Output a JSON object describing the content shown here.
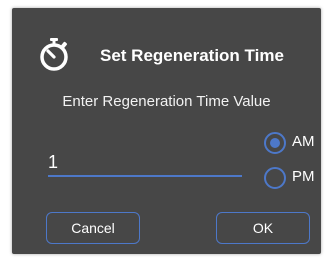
{
  "dialog": {
    "title": "Set Regeneration Time",
    "icon": "stopwatch-icon",
    "prompt": "Enter Regeneration Time Value",
    "time_value": "1",
    "meridiem": {
      "options": [
        "AM",
        "PM"
      ],
      "selected": "AM"
    },
    "buttons": {
      "cancel": "Cancel",
      "ok": "OK"
    }
  },
  "colors": {
    "dialog_background": "#474747",
    "accent": "#4d78c9",
    "text": "#ffffff"
  }
}
